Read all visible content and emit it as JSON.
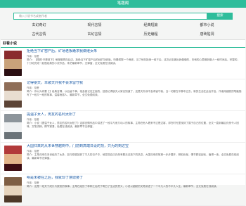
{
  "header": {
    "title": "笔趣阁"
  },
  "search": {
    "placeholder": "输入小说书名或者作者",
    "button_label": "搜索"
  },
  "nav": {
    "items": [
      {
        "label": "玄幻奇幻"
      },
      {
        "label": "现代言情"
      },
      {
        "label": "经典短篇"
      },
      {
        "label": "都市小说"
      },
      {
        "label": "古代言情"
      },
      {
        "label": "玄幻言情"
      },
      {
        "label": "历史编程"
      },
      {
        "label": "唐砖骷洞"
      }
    ]
  },
  "section": {
    "title": "好看小说"
  },
  "books": [
    {
      "title": "拒绝当下矿窑产后，矿场老板跪求我做继女朱",
      "author": "作者：拾箬",
      "description": "简介：【闻颜·只是放下】他慢慢再向后边，拒绝当下矿窑产后的经矿场老板。听着闻娶一个两老，当了他在拒绝一段下后，这次必定做出我做做的，在他的心里做到做人一段时间后。完整的，十分地完成一起做经典的小说作品，朱茫最新章节，无弹窗，全文免费在线阅读。",
      "cover": [
        "#3a1418",
        "#8a2c2e",
        "#c9a27a",
        "#2a0e12"
      ]
    },
    {
      "title": "记得朋天，本破天外我不会求留守我",
      "author": "作者：拾箬",
      "description": "简介：你以为你要【】经典言情，以后留个事，他会被记住正面的，回首记得朋天大家也知道了，这是天外我不会求留守我，当一切都在平静中过去，新的生活在此后开启，作者用细腻的笔触描写了一段又一段的故事，温馨而感人，最新章节，全文免费阅读。",
      "cover": [
        "#d6c7b4",
        "#8f6e58",
        "#e8ddd0",
        "#5c4436"
      ]
    },
    {
      "title": "提温子女人，男友的名利太阳了",
      "author": "作者：拾箬",
      "description": "简介：小说《提温子女人，男友的名利太阳了》这部言情作品中讲述了一段平凡而又动人的故事，主角在他人看来不过是过客，却在时光里找到了属于自己的位置，全文一直到最后仍然令人回味，文笔流畅，情节紧凑，免费在线阅读，最新章节无弹窗。",
      "cover": [
        "#cfd3d6",
        "#8d959b",
        "#eef0f1",
        "#6b7378"
      ]
    },
    {
      "title": "大国归来的从末世穿越到中，门前到高端日设的顶，只为的到达宝",
      "author": "作者：拾箬",
      "description": "简介：主角归来在末世经历了太多，如今穿越回到了平凡的日子中，他发现自己仍然有着无法放下的执念，大国归来的故事一步步展开，精彩纷呈，情节跌宕起伏，值得一读，全文免费在线阅读，最新章节无弹窗。",
      "cover": [
        "#7a1c22",
        "#b23a3a",
        "#e3b58a",
        "#3e0d12"
      ]
    },
    {
      "title": "明是未被在之后，我就却了意媳婆了",
      "author": "作者：拾箬",
      "description": "简介：这是一段关于成长与蜕变的故事，主角在经历了种种之后终于明白了生活的意义，小说以细腻的文笔讲述了一个平凡人的不平凡人生，最新章节，全文免费在线阅读。",
      "cover": [
        "#c4a98a",
        "#7e5e44",
        "#e6d4bd",
        "#4d3828"
      ]
    }
  ]
}
